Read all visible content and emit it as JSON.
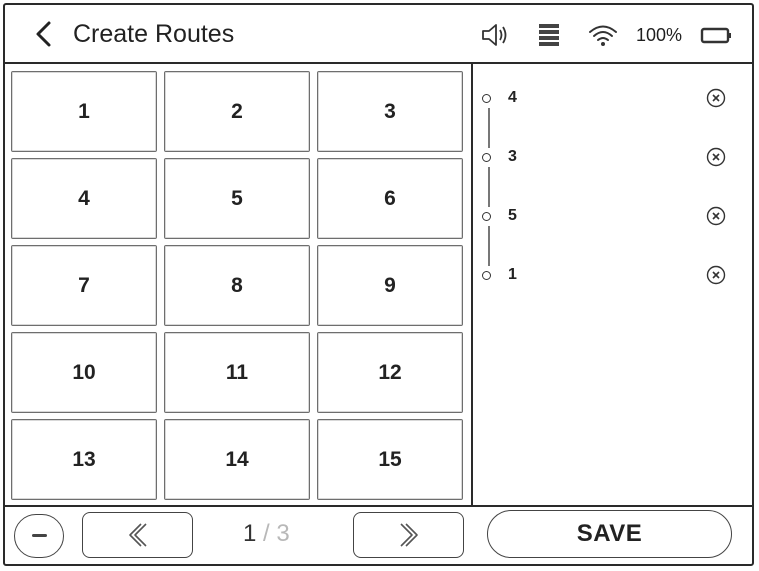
{
  "header": {
    "title": "Create Routes",
    "battery_percent": "100%",
    "icons": [
      "back-chevron-icon",
      "speaker-icon",
      "storage-icon",
      "wifi-icon",
      "battery-icon"
    ]
  },
  "keypad": {
    "keys": [
      "1",
      "2",
      "3",
      "4",
      "5",
      "6",
      "7",
      "8",
      "9",
      "10",
      "11",
      "12",
      "13",
      "14",
      "15"
    ]
  },
  "route": {
    "items": [
      {
        "label": "4"
      },
      {
        "label": "3"
      },
      {
        "label": "5"
      },
      {
        "label": "1"
      }
    ],
    "remove_icon": "remove-circle-x-icon"
  },
  "footer": {
    "current_page": "1",
    "separator": "/",
    "total_pages": "3",
    "save_label": "SAVE",
    "icons": [
      "minus-icon",
      "chevron-left-icon",
      "chevron-right-icon"
    ]
  }
}
